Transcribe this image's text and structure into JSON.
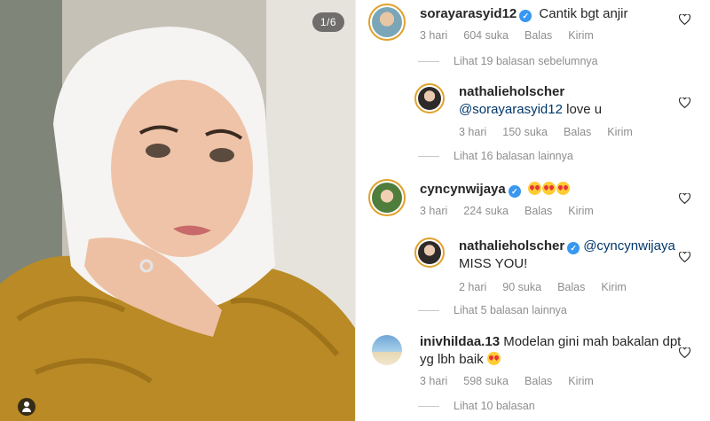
{
  "photo": {
    "counter": "1/6"
  },
  "comments": [
    {
      "username": "sorayarasyid12",
      "verified": true,
      "text": "Cantik bgt anjir",
      "time": "3 hari",
      "likes": "604 suka",
      "reply": "Balas",
      "send": "Kirim",
      "more": "Lihat 19 balasan sebelumnya"
    },
    {
      "username": "nathalieholscher",
      "verified": false,
      "mention": "@sorayarasyid12",
      "text": " love u",
      "time": "3 hari",
      "likes": "150 suka",
      "reply": "Balas",
      "send": "Kirim",
      "more": "Lihat 16 balasan lainnya"
    },
    {
      "username": "cyncynwijaya",
      "verified": true,
      "text": "",
      "time": "3 hari",
      "likes": "224 suka",
      "reply": "Balas",
      "send": "Kirim"
    },
    {
      "username": "nathalieholscher",
      "verified": true,
      "mention": "@cyncynwijaya",
      "text": "MISS YOU!",
      "time": "2 hari",
      "likes": "90 suka",
      "reply": "Balas",
      "send": "Kirim",
      "more": "Lihat 5 balasan lainnya"
    },
    {
      "username": "inivhildaa.13",
      "verified": false,
      "text": "Modelan gini mah bakalan dpt yg lbh baik",
      "time": "3 hari",
      "likes": "598 suka",
      "reply": "Balas",
      "send": "Kirim",
      "more": "Lihat 10 balasan"
    }
  ],
  "colors": {
    "verified": "#3897f0",
    "story_ring": "#e0a12b",
    "muted": "#8e8e8e"
  }
}
